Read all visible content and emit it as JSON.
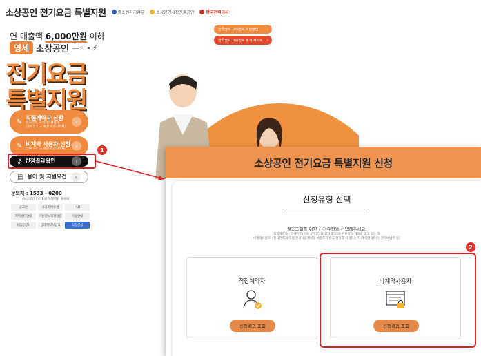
{
  "header": {
    "title": "소상공인 전기요금 특별지원",
    "partners": [
      "중소벤처기업부",
      "소상공인시장진흥공단",
      "한국전력공사"
    ]
  },
  "hero": {
    "line1_prefix": "연 매출액",
    "line1_amount": "6,000만원",
    "line1_suffix": "이하",
    "badge": "영세",
    "badge_text": "소상공인",
    "big1": "전기요금",
    "big2": "특별지원"
  },
  "menu": {
    "direct": {
      "label": "직접계약자 신청",
      "sub1": "한국전력, 구역전기사업자",
      "sub2": "('24.2.1. ~ 예산 소진시까지)"
    },
    "indirect": {
      "label": "비계약 사용자 신청",
      "sub1": "('24.3.4. ~ 예산 소진시까지)"
    },
    "result": {
      "label": "신청결과확인"
    },
    "terms": {
      "label": "용어 및 지원요건"
    }
  },
  "contact": {
    "label": "문의처 : 1533 - 0200",
    "sub": "(소상공인 전기요금 특별지원 콜센터)"
  },
  "quick_links": [
    "공고문",
    "사용자매뉴얼",
    "FAQ",
    "지역센터안내",
    "개인정보처리방침",
    "이용안내",
    "위임장양식",
    "임대계약서양식",
    "직접신청"
  ],
  "pills": [
    {
      "label": "한국전력 고객번호 확인방법"
    },
    {
      "label": "한국전력 고객번호 찾기 사이트"
    }
  ],
  "markers": [
    "1",
    "2"
  ],
  "modal": {
    "title": "소상공인 전기요금 특별지원 신청",
    "card_title": "신청유형 선택",
    "desc1": "결과조회를 위한 신청유형을 선택해주세요.",
    "desc2": "직접계약자 : 한국전력(이하 구역전기사업자 포함)과 본인명의 계약을 맺고 있는 자",
    "desc3": "비계약사용자 : 한국전력과 직접 전기사용계약을 체결하지 않고 전기를 사용하는 자(계약명의타인, 관리비납부 등)",
    "options": [
      {
        "label": "직접계약자",
        "button": "신청결과 조회",
        "icon": "person-check-icon"
      },
      {
        "label": "비계약사용자",
        "button": "신청결과 조회",
        "icon": "document-lock-icon"
      }
    ]
  },
  "colors": {
    "accent": "#f08a3e",
    "highlight": "#e02020",
    "modal_header": "#ef9450"
  }
}
